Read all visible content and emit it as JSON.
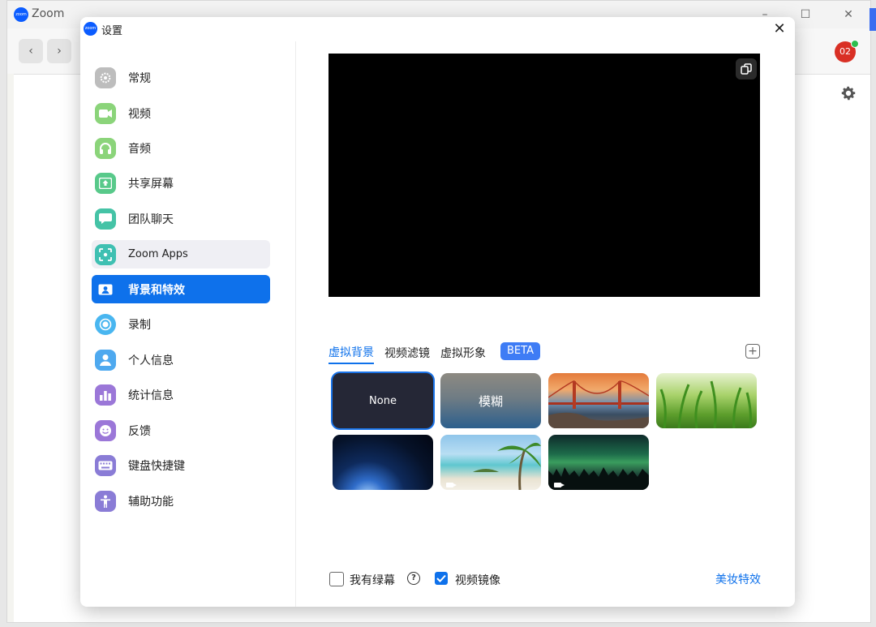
{
  "app": {
    "title": "Zoom",
    "logo_text": "zoom"
  },
  "background_window": {
    "notification_count": "02"
  },
  "dialog": {
    "title": "设置",
    "close_glyph": "✕"
  },
  "sidebar": {
    "items": [
      {
        "label": "常规",
        "icon": "gear-icon",
        "color": "#bdbdbd"
      },
      {
        "label": "视频",
        "icon": "video-icon",
        "color": "#8bd47a"
      },
      {
        "label": "音频",
        "icon": "headphones-icon",
        "color": "#8bd47a"
      },
      {
        "label": "共享屏幕",
        "icon": "share-screen-icon",
        "color": "#58c98a"
      },
      {
        "label": "团队聊天",
        "icon": "chat-icon",
        "color": "#45c3a6"
      },
      {
        "label": "Zoom Apps",
        "icon": "apps-icon",
        "color": "#3fc0b2"
      },
      {
        "label": "背景和特效",
        "icon": "background-effects-icon",
        "color": "#0e71eb"
      },
      {
        "label": "录制",
        "icon": "record-icon",
        "color": "#49b6f0"
      },
      {
        "label": "个人信息",
        "icon": "profile-icon",
        "color": "#4ea9ef"
      },
      {
        "label": "统计信息",
        "icon": "statistics-icon",
        "color": "#9b77d8"
      },
      {
        "label": "反馈",
        "icon": "feedback-icon",
        "color": "#9b77d8"
      },
      {
        "label": "键盘快捷键",
        "icon": "keyboard-icon",
        "color": "#8a7cd6"
      },
      {
        "label": "辅助功能",
        "icon": "accessibility-icon",
        "color": "#8a7cd6"
      }
    ],
    "active_index": 6,
    "hover_index": 5
  },
  "tabs": [
    {
      "label": "虚拟背景",
      "active": true
    },
    {
      "label": "视频滤镜",
      "active": false
    },
    {
      "label": "虚拟形象",
      "active": false
    }
  ],
  "beta_badge": "BETA",
  "backgrounds": [
    {
      "name": "none",
      "label": "None",
      "selected": true
    },
    {
      "name": "blur",
      "label": "模糊"
    },
    {
      "name": "golden-gate-bridge",
      "label": ""
    },
    {
      "name": "grass",
      "label": ""
    },
    {
      "name": "earth-from-space",
      "label": ""
    },
    {
      "name": "beach-palm",
      "label": "",
      "video": true
    },
    {
      "name": "aurora",
      "label": "",
      "video": true
    }
  ],
  "options": {
    "green_screen_label": "我有绿幕",
    "green_screen_checked": false,
    "mirror_label": "视频镜像",
    "mirror_checked": true,
    "beauty_link": "美妆特效"
  },
  "colors": {
    "accent": "#0e71eb",
    "preview_bg": "#000000"
  }
}
